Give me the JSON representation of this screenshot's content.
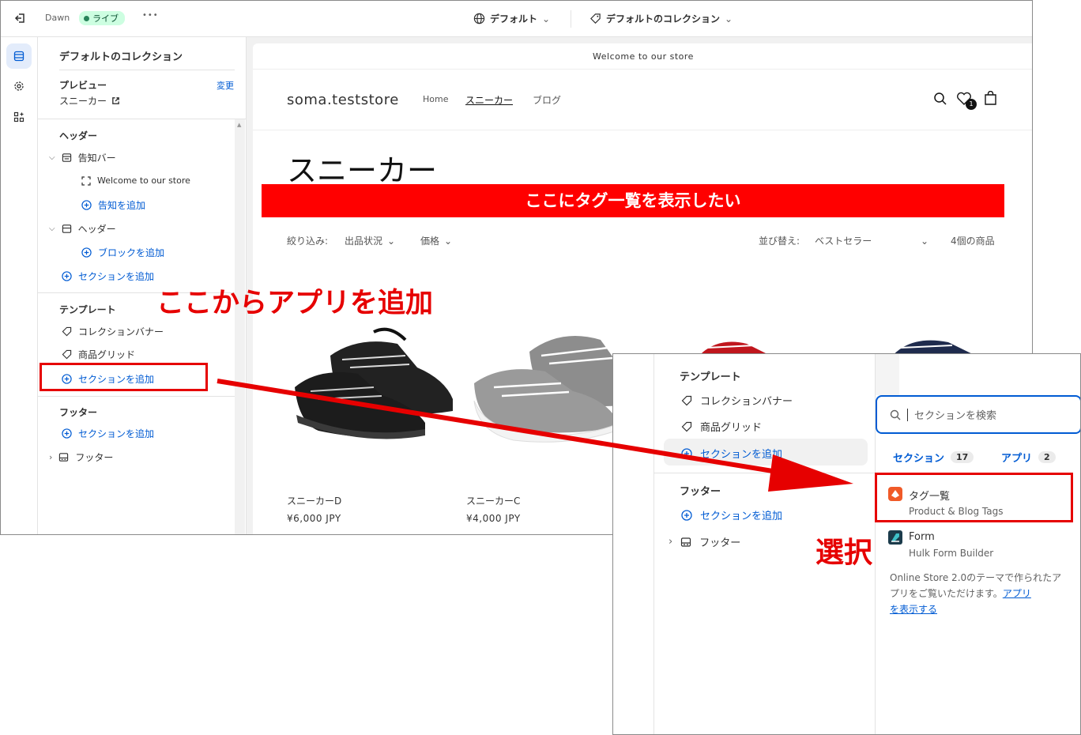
{
  "topbar": {
    "theme_name": "Dawn",
    "live_label": "ライブ",
    "more_label": "•••",
    "default_label": "デフォルト",
    "collection_label": "デフォルトのコレクション"
  },
  "sidebar": {
    "title": "デフォルトのコレクション",
    "preview_label": "プレビュー",
    "preview_value": "スニーカー",
    "change_label": "変更",
    "header_section": "ヘッダー",
    "announcement_bar": "告知バー",
    "welcome_item": "Welcome to our store",
    "add_announcement": "告知を追加",
    "header_item": "ヘッダー",
    "add_block": "ブロックを追加",
    "add_section_1": "セクションを追加",
    "template_section": "テンプレート",
    "collection_banner": "コレクションバナー",
    "product_grid": "商品グリッド",
    "add_section_2": "セクションを追加",
    "footer_section": "フッター",
    "add_section_3": "セクションを追加",
    "footer_item": "フッター"
  },
  "store": {
    "announcement": "Welcome to our store",
    "logo": "soma.teststore",
    "nav": [
      "Home",
      "スニーカー",
      "ブログ"
    ],
    "wishlist_count": "1",
    "collection_title": "スニーカー",
    "filter_label": "絞り込み:",
    "filter_availability": "出品状況",
    "filter_price": "価格",
    "sort_label": "並び替え:",
    "sort_value": "ベストセラー",
    "product_count": "4個の商品",
    "products": [
      {
        "name": "スニーカーD",
        "price": "¥6,000 JPY"
      },
      {
        "name": "スニーカーC",
        "price": "¥4,000 JPY"
      }
    ]
  },
  "annotations": {
    "banner_text": "ここにタグ一覧を表示したい",
    "add_app_text": "ここからアプリを追加",
    "select_text": "選択"
  },
  "zoom_panel": {
    "template_section": "テンプレート",
    "collection_banner": "コレクションバナー",
    "product_grid": "商品グリッド",
    "add_section_1": "セクションを追加",
    "footer_section": "フッター",
    "add_section_2": "セクションを追加",
    "footer_item": "フッター",
    "search_placeholder": "セクションを検索",
    "tab_sections": "セクション",
    "tab_sections_count": "17",
    "tab_apps": "アプリ",
    "tab_apps_count": "2",
    "apps": [
      {
        "name": "タグ一覧",
        "sub": "Product & Blog Tags",
        "icon": "tag-app-icon",
        "color": "#f05a28"
      },
      {
        "name": "Form",
        "sub": "Hulk Form Builder",
        "icon": "form-app-icon",
        "color": "#1b3b4b"
      }
    ],
    "note_text": "Online Store 2.0のテーマで作られたアプリをご覧いただけます。",
    "note_link_1": "アプリ",
    "note_link_2": "を表示する"
  },
  "colors": {
    "accent": "#005bd3",
    "annotation_red": "#e60000",
    "banner_red": "#ff0000"
  }
}
